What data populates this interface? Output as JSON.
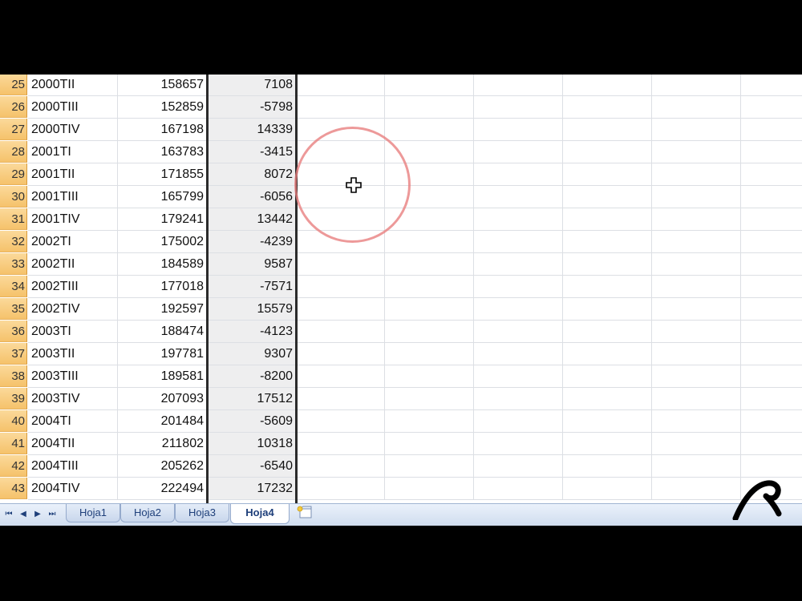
{
  "rows": [
    {
      "num": "25",
      "label": "2000TII",
      "value": "158657",
      "diff": "7108"
    },
    {
      "num": "26",
      "label": "2000TIII",
      "value": "152859",
      "diff": "-5798"
    },
    {
      "num": "27",
      "label": "2000TIV",
      "value": "167198",
      "diff": "14339"
    },
    {
      "num": "28",
      "label": "2001TI",
      "value": "163783",
      "diff": "-3415"
    },
    {
      "num": "29",
      "label": "2001TII",
      "value": "171855",
      "diff": "8072"
    },
    {
      "num": "30",
      "label": "2001TIII",
      "value": "165799",
      "diff": "-6056"
    },
    {
      "num": "31",
      "label": "2001TIV",
      "value": "179241",
      "diff": "13442"
    },
    {
      "num": "32",
      "label": "2002TI",
      "value": "175002",
      "diff": "-4239"
    },
    {
      "num": "33",
      "label": "2002TII",
      "value": "184589",
      "diff": "9587"
    },
    {
      "num": "34",
      "label": "2002TIII",
      "value": "177018",
      "diff": "-7571"
    },
    {
      "num": "35",
      "label": "2002TIV",
      "value": "192597",
      "diff": "15579"
    },
    {
      "num": "36",
      "label": "2003TI",
      "value": "188474",
      "diff": "-4123"
    },
    {
      "num": "37",
      "label": "2003TII",
      "value": "197781",
      "diff": "9307"
    },
    {
      "num": "38",
      "label": "2003TIII",
      "value": "189581",
      "diff": "-8200"
    },
    {
      "num": "39",
      "label": "2003TIV",
      "value": "207093",
      "diff": "17512"
    },
    {
      "num": "40",
      "label": "2004TI",
      "value": "201484",
      "diff": "-5609"
    },
    {
      "num": "41",
      "label": "2004TII",
      "value": "211802",
      "diff": "10318"
    },
    {
      "num": "42",
      "label": "2004TIII",
      "value": "205262",
      "diff": "-6540"
    },
    {
      "num": "43",
      "label": "2004TIV",
      "value": "222494",
      "diff": "17232"
    }
  ],
  "sheet_tabs": [
    "Hoja1",
    "Hoja2",
    "Hoja3",
    "Hoja4"
  ],
  "active_tab": "Hoja4",
  "nav_icons": [
    "first-sheet-icon",
    "prev-sheet-icon",
    "next-sheet-icon",
    "last-sheet-icon"
  ],
  "nav_glyphs": [
    "⏮",
    "◀",
    "▶",
    "⏭"
  ],
  "colors": {
    "row_header": "#f5c26b",
    "selection_border": "#2b2b2b",
    "highlight_circle": "#e8807f",
    "tab_text": "#1e3f7a"
  }
}
